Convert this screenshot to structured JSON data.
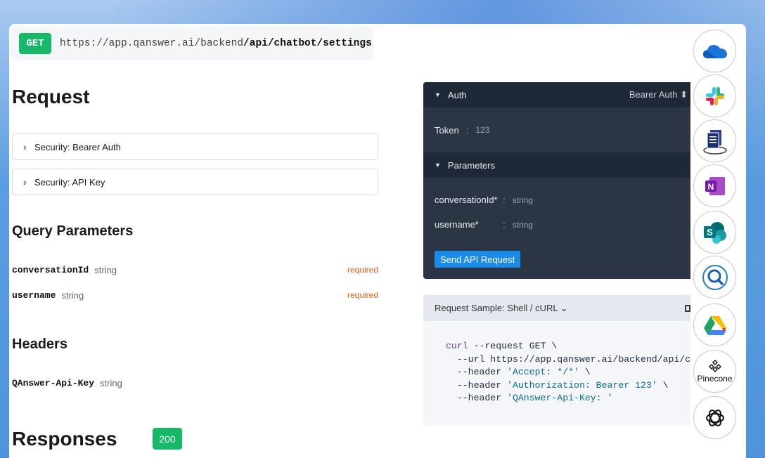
{
  "endpoint": {
    "method": "GET",
    "base_url": "https://app.qanswer.ai/backend",
    "path": "/api/chatbot/settings"
  },
  "request": {
    "title": "Request",
    "security": [
      {
        "label": "Security: Bearer Auth"
      },
      {
        "label": "Security: API Key"
      }
    ]
  },
  "query_params": {
    "title": "Query Parameters",
    "items": [
      {
        "name": "conversationId",
        "type": "string",
        "required": "required"
      },
      {
        "name": "username",
        "type": "string",
        "required": "required"
      }
    ]
  },
  "headers": {
    "title": "Headers",
    "items": [
      {
        "name": "QAnswer-Api-Key",
        "type": "string"
      }
    ]
  },
  "responses": {
    "title": "Responses",
    "status": "200"
  },
  "try_panel": {
    "auth_label": "Auth",
    "auth_type": "Bearer Auth",
    "token_label": "Token",
    "token_value": "123",
    "params_label": "Parameters",
    "params": [
      {
        "name": "conversationId*",
        "type": "string"
      },
      {
        "name": "username*",
        "type": "string"
      }
    ],
    "send_label": "Send API Request",
    "separator": ":"
  },
  "sample": {
    "header": "Request Sample: Shell / cURL",
    "lines": [
      [
        "curl",
        " --request GET \\"
      ],
      [
        "",
        "  --url https://app.qanswer.ai/backend/api/ch"
      ],
      [
        "",
        "  --header ",
        "'Accept: */*'",
        " \\"
      ],
      [
        "",
        "  --header ",
        "'Authorization: Bearer 123'",
        " \\"
      ],
      [
        "",
        "  --header ",
        "'QAnswer-Api-Key: '"
      ]
    ]
  },
  "integrations": [
    {
      "name": "onedrive-icon",
      "label": ""
    },
    {
      "name": "slack-icon",
      "label": ""
    },
    {
      "name": "documents-icon",
      "label": ""
    },
    {
      "name": "onenote-icon",
      "label": ""
    },
    {
      "name": "sharepoint-icon",
      "label": ""
    },
    {
      "name": "search-icon",
      "label": ""
    },
    {
      "name": "google-drive-icon",
      "label": ""
    },
    {
      "name": "pinecone-icon",
      "label": "Pinecone"
    },
    {
      "name": "openai-icon",
      "label": ""
    }
  ],
  "colors": {
    "method_green": "#18b86b",
    "required_orange": "#e8651a",
    "panel_dark": "#2b3544",
    "send_blue": "#1a8ce8"
  }
}
